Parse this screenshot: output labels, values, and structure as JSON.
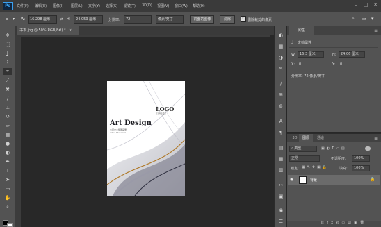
{
  "app": {
    "logo": "Ps"
  },
  "menu": [
    "文件(F)",
    "编辑(E)",
    "图像(I)",
    "图层(L)",
    "文字(Y)",
    "选择(S)",
    "滤镜(T)",
    "3D(D)",
    "视图(V)",
    "窗口(W)",
    "帮助(H)"
  ],
  "options": {
    "width_label": "W:",
    "width_value": "16.298 厘米",
    "height_label": "H:",
    "height_value": "24.059 厘米",
    "resolution_label": "分辨率:",
    "resolution_value": "72",
    "resolution_unit": "像素/英寸",
    "front_image_button": "前面的图像",
    "clear_button": "清除",
    "delete_crop_label": "删除裁剪的像素",
    "delete_crop_checked": true
  },
  "document": {
    "tab_title": "书本.jpg @ 50%(RGB/8#) *",
    "close": "×",
    "art_title": "Art Design",
    "art_subtitle": "公司企业集团画册",
    "art_tagline": "Artist Standard",
    "logo": "LOGO",
    "logo_sub": "企业标志设计"
  },
  "properties": {
    "tab": "属性",
    "section": "文档属性",
    "w_label": "W:",
    "w_value": "16.3 厘米",
    "h_label": "H:",
    "h_value": "24.06 厘米",
    "x_label": "X:",
    "x_value": "0",
    "y_label": "Y:",
    "y_value": "0",
    "resolution": "分辨率: 72 像素/英寸"
  },
  "layers": {
    "tabs": [
      "3D",
      "图层",
      "通道"
    ],
    "active_tab": "图层",
    "filter": "类型",
    "blend_mode": "正常",
    "opacity_label": "不透明度:",
    "opacity_value": "100%",
    "lock_label": "锁定:",
    "fill_label": "填充:",
    "fill_value": "100%",
    "items": [
      {
        "name": "背景",
        "visible": true,
        "locked": true
      }
    ]
  },
  "colors": {
    "accent": "#3aa0f0",
    "app_bg": "#282828",
    "panel": "#535353"
  }
}
